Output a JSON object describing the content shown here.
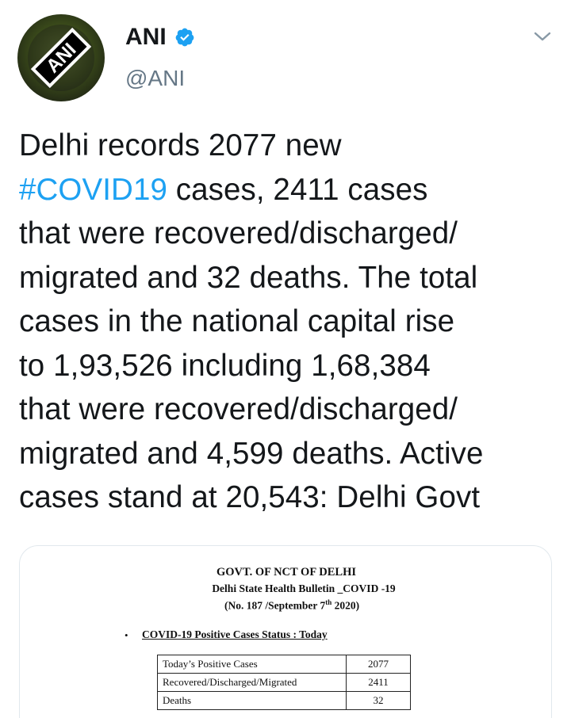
{
  "tweet": {
    "author": {
      "display_name": "ANI",
      "handle": "@ANI",
      "avatar_text": "ANI",
      "verified": true
    },
    "menu_icon": "chevron-down-icon",
    "text_lines": [
      {
        "parts": [
          {
            "text": "Delhi records 2077 new",
            "type": "text"
          }
        ]
      },
      {
        "parts": [
          {
            "text": "#COVID19",
            "type": "hashtag"
          },
          {
            "text": " cases, 2411 cases",
            "type": "text"
          }
        ]
      },
      {
        "parts": [
          {
            "text": "that were recovered/discharged/",
            "type": "text"
          }
        ]
      },
      {
        "parts": [
          {
            "text": "migrated and 32 deaths. The total",
            "type": "text"
          }
        ]
      },
      {
        "parts": [
          {
            "text": "cases in the national capital rise",
            "type": "text"
          }
        ]
      },
      {
        "parts": [
          {
            "text": "to 1,93,526 including 1,68,384",
            "type": "text"
          }
        ]
      },
      {
        "parts": [
          {
            "text": "that were recovered/discharged/",
            "type": "text"
          }
        ]
      },
      {
        "parts": [
          {
            "text": "migrated and 4,599 deaths. Active",
            "type": "text"
          }
        ]
      },
      {
        "parts": [
          {
            "text": "cases stand at 20,543: Delhi Govt",
            "type": "text"
          }
        ]
      }
    ],
    "colors": {
      "hashtag": "#1da1f2",
      "verified": "#1da1f2",
      "secondary_text": "#657786"
    }
  },
  "media": {
    "title": "GOVT. OF NCT OF DELHI",
    "subtitle": "Delhi State Health Bulletin _COVID -19",
    "bulletin_no_prefix": "(No. 187 /September 7",
    "bulletin_no_sup": "th",
    "bulletin_no_suffix": " 2020)",
    "bullet": "•",
    "section_heading": "COVID-19 Positive Cases Status : Today",
    "table": [
      {
        "label": "Today’s Positive Cases",
        "value": "2077"
      },
      {
        "label": "Recovered/Discharged/Migrated",
        "value": "2411"
      },
      {
        "label": "Deaths",
        "value": "32"
      }
    ]
  }
}
